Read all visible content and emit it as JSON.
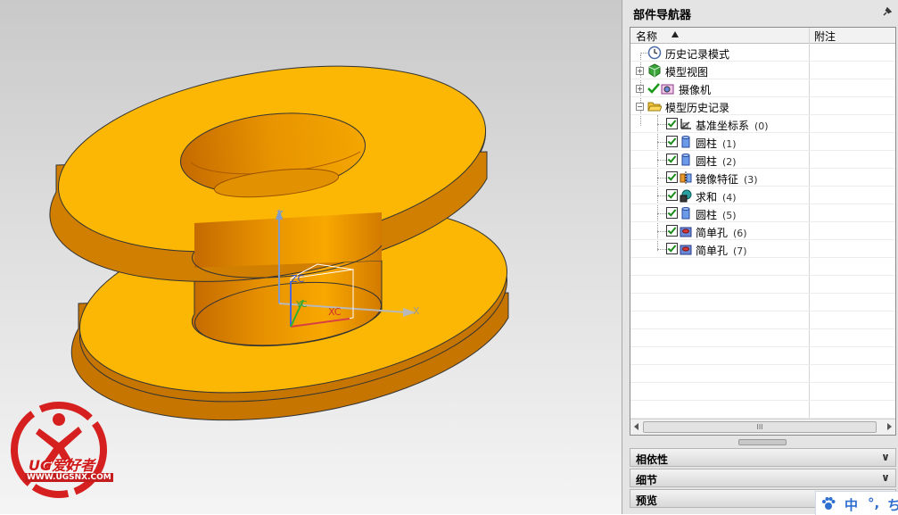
{
  "viewport": {
    "axes": {
      "z": "Z",
      "zc": "ZC",
      "yc": "YC",
      "xc": "XC",
      "x": "X"
    },
    "model_color": "#fbb703"
  },
  "logo": {
    "brand": "UG爱好者",
    "url": "WWW.UGSNX.COM"
  },
  "navigator": {
    "title": "部件导航器",
    "columns": {
      "name": "名称",
      "note": "附注"
    },
    "items": [
      {
        "label": "历史记录模式",
        "num": "",
        "icon": "clock-icon"
      },
      {
        "label": "模型视图",
        "num": "",
        "icon": "model-views-icon"
      },
      {
        "label": "摄像机",
        "num": "",
        "icon": "camera-icon"
      },
      {
        "label": "模型历史记录",
        "num": "",
        "icon": "folder-open-icon"
      },
      {
        "label": "基准坐标系",
        "num": "(0)",
        "icon": "datum-csys-icon"
      },
      {
        "label": "圆柱",
        "num": "(1)",
        "icon": "cylinder-icon"
      },
      {
        "label": "圆柱",
        "num": "(2)",
        "icon": "cylinder-icon"
      },
      {
        "label": "镜像特征",
        "num": "(3)",
        "icon": "mirror-feature-icon"
      },
      {
        "label": "求和",
        "num": "(4)",
        "icon": "unite-icon"
      },
      {
        "label": "圆柱",
        "num": "(5)",
        "icon": "cylinder-icon"
      },
      {
        "label": "简单孔",
        "num": "(6)",
        "icon": "hole-icon"
      },
      {
        "label": "简单孔",
        "num": "(7)",
        "icon": "hole-icon"
      }
    ],
    "scroll_thumb": "III",
    "sections": [
      "相依性",
      "细节",
      "预览"
    ]
  },
  "ime": {
    "lang": "中",
    "dot": "°,",
    "extra": "ち"
  }
}
